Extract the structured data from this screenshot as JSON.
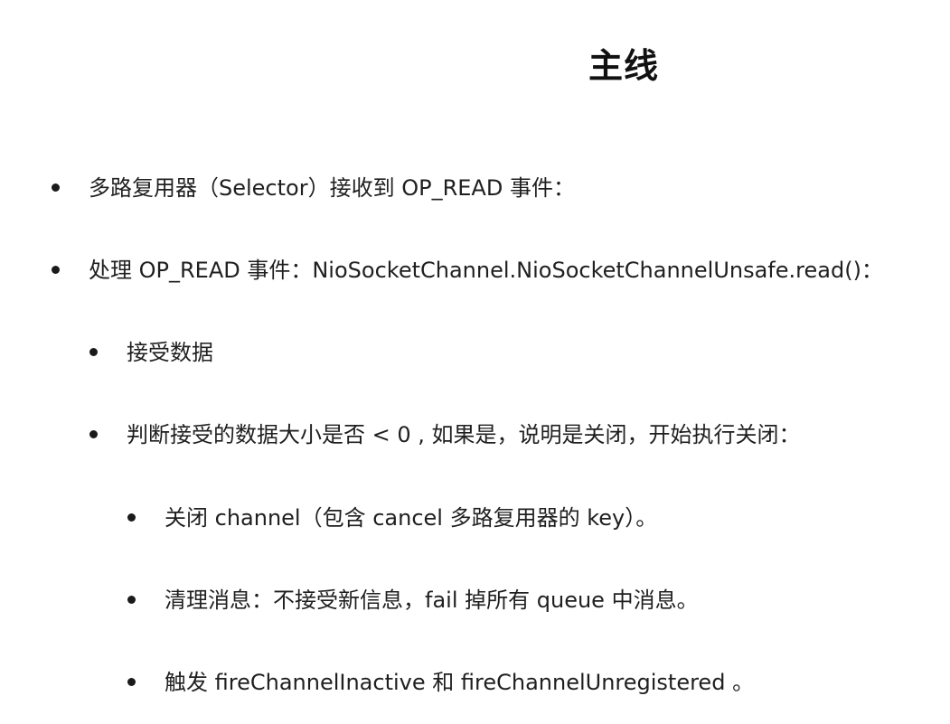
{
  "title": "主线",
  "bullets": [
    {
      "level": 1,
      "text": "多路复用器（Selector）接收到 OP_READ 事件："
    },
    {
      "level": 1,
      "text": "处理 OP_READ 事件：NioSocketChannel.NioSocketChannelUnsafe.read()："
    },
    {
      "level": 2,
      "text": "接受数据"
    },
    {
      "level": 2,
      "text": "判断接受的数据大小是否 < 0 , 如果是，说明是关闭，开始执行关闭："
    },
    {
      "level": 3,
      "text": "关闭 channel（包含 cancel 多路复用器的 key）。"
    },
    {
      "level": 3,
      "text": "清理消息：不接受新信息，fail 掉所有 queue 中消息。"
    },
    {
      "level": 3,
      "text": "触发 fireChannelInactive 和 fireChannelUnregistered 。"
    }
  ]
}
